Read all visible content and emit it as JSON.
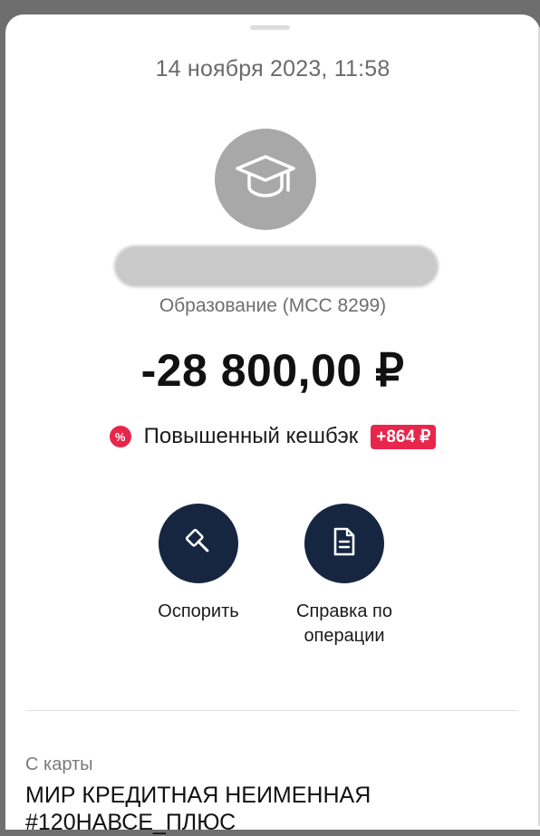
{
  "operation": {
    "datetime": "14 ноября 2023, 11:58",
    "category_icon": "graduation-cap-icon",
    "category": "Образование (MCC 8299)",
    "amount": "-28 800,00 ₽"
  },
  "cashback": {
    "badge_icon": "percent-icon",
    "badge_symbol": "%",
    "label": "Повышенный кешбэк",
    "value": "+864 ₽"
  },
  "actions": {
    "dispute_icon": "gavel-icon",
    "dispute_label": "Оспорить",
    "certificate_icon": "document-icon",
    "certificate_label": "Справка по операции"
  },
  "source": {
    "label": "С карты",
    "card_name": "МИР КРЕДИТНАЯ НЕИМЕННАЯ #120НАВСЕ_ПЛЮС"
  },
  "colors": {
    "accent_red": "#e8264c",
    "action_navy": "#162640",
    "category_gray": "#a8a8a8"
  }
}
